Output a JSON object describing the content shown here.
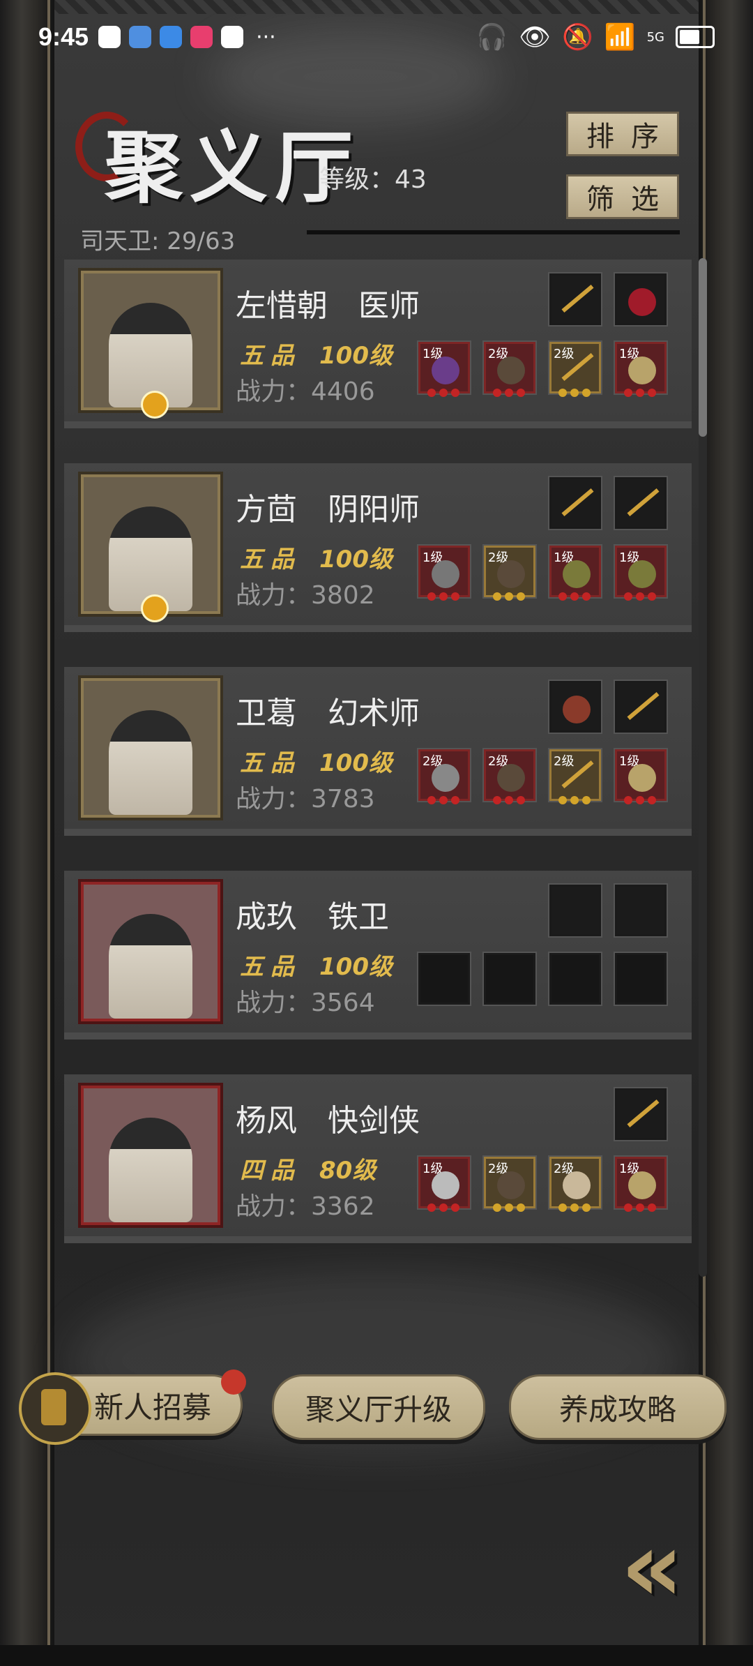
{
  "status_bar": {
    "time": "9:45",
    "more": "···",
    "network": "5G"
  },
  "header": {
    "title": "聚义厅",
    "level_label": "等级：43",
    "guard_count": "司天卫: 29/63",
    "sort_button": "排序",
    "filter_button": "筛选"
  },
  "members": [
    {
      "name": "左惜朝　医师",
      "rank": "五品",
      "level": "100级",
      "power": "战力：4406",
      "frame": "gold",
      "badge": true,
      "top_slots": [
        {
          "filled": true,
          "item": "staff"
        },
        {
          "filled": true,
          "item": "gem"
        }
      ],
      "bottom_slots": [
        {
          "lv": "1级",
          "frame": "red",
          "item": "gourd"
        },
        {
          "lv": "2级",
          "frame": "red",
          "item": "armor"
        },
        {
          "lv": "2级",
          "frame": "gold",
          "item": "staff"
        },
        {
          "lv": "1级",
          "frame": "red",
          "item": "pouch"
        }
      ]
    },
    {
      "name": "方茴　阴阳师",
      "rank": "五品",
      "level": "100级",
      "power": "战力：3802",
      "frame": "gold",
      "badge": true,
      "top_slots": [
        {
          "filled": true,
          "item": "staff"
        },
        {
          "filled": true,
          "item": "staff"
        }
      ],
      "bottom_slots": [
        {
          "lv": "1级",
          "frame": "red",
          "item": "hammer"
        },
        {
          "lv": "2级",
          "frame": "gold",
          "item": "armor"
        },
        {
          "lv": "1级",
          "frame": "red",
          "item": "coin"
        },
        {
          "lv": "1级",
          "frame": "red",
          "item": "coin"
        }
      ]
    },
    {
      "name": "卫葛　幻术师",
      "rank": "五品",
      "level": "100级",
      "power": "战力：3783",
      "frame": "gold",
      "badge": false,
      "top_slots": [
        {
          "filled": true,
          "item": "mushroom"
        },
        {
          "filled": true,
          "item": "needle"
        }
      ],
      "bottom_slots": [
        {
          "lv": "2级",
          "frame": "red",
          "item": "axe"
        },
        {
          "lv": "2级",
          "frame": "red",
          "item": "armor"
        },
        {
          "lv": "2级",
          "frame": "gold",
          "item": "staff"
        },
        {
          "lv": "1级",
          "frame": "red",
          "item": "pouch"
        }
      ]
    },
    {
      "name": "成玖　铁卫",
      "rank": "五品",
      "level": "100级",
      "power": "战力：3564",
      "frame": "red",
      "badge": false,
      "top_slots": [
        {
          "filled": false
        },
        {
          "filled": false
        }
      ],
      "bottom_slots": [
        {
          "lv": "",
          "frame": "empty"
        },
        {
          "lv": "",
          "frame": "empty"
        },
        {
          "lv": "",
          "frame": "empty"
        },
        {
          "lv": "",
          "frame": "empty"
        }
      ]
    },
    {
      "name": "杨风　快剑侠",
      "rank": "四品",
      "level": "80级",
      "power": "战力：3362",
      "frame": "red",
      "badge": false,
      "top_slots": [
        {
          "filled": true,
          "item": "staff"
        }
      ],
      "bottom_slots": [
        {
          "lv": "1级",
          "frame": "red",
          "item": "sword"
        },
        {
          "lv": "2级",
          "frame": "gold",
          "item": "armor"
        },
        {
          "lv": "2级",
          "frame": "gold",
          "item": "boots"
        },
        {
          "lv": "1级",
          "frame": "red",
          "item": "pouch"
        }
      ]
    }
  ],
  "bottom_buttons": {
    "recruit": "新人招募",
    "upgrade": "聚义厅升级",
    "guide": "养成攻略"
  },
  "colors": {
    "gold": "#e2bb4d",
    "frame_gold": "#8c7a52",
    "frame_red": "#8e2525",
    "button_bg": "#cdbf9e"
  }
}
